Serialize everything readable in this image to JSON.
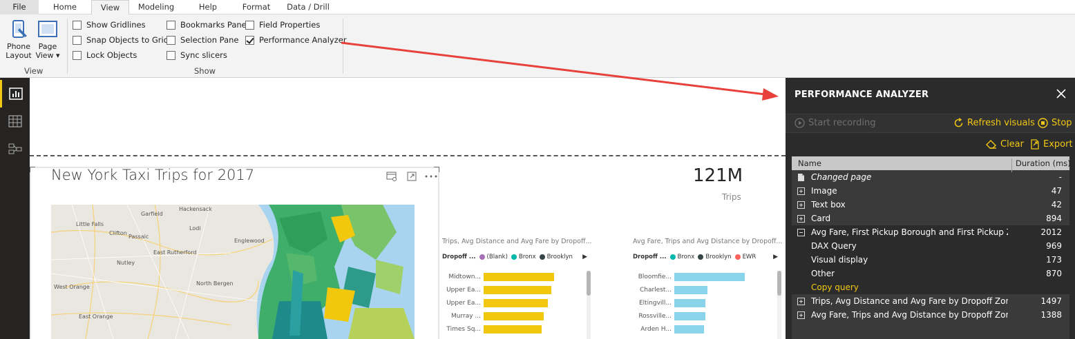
{
  "ribbon": {
    "tabs": [
      "File",
      "Home",
      "View",
      "Modeling",
      "Help",
      "Format",
      "Data / Drill"
    ],
    "active_tab": "View",
    "view_group": {
      "phone_layout_line1": "Phone",
      "phone_layout_line2": "Layout",
      "page_view_line1": "Page",
      "page_view_line2": "View ▾",
      "label": "View"
    },
    "show_group": {
      "label": "Show",
      "checkboxes": [
        {
          "label": "Show Gridlines",
          "checked": false
        },
        {
          "label": "Snap Objects to Grid",
          "checked": false
        },
        {
          "label": "Lock Objects",
          "checked": false
        },
        {
          "label": "Bookmarks Pane",
          "checked": false
        },
        {
          "label": "Selection Pane",
          "checked": false
        },
        {
          "label": "Sync slicers",
          "checked": false
        },
        {
          "label": "Field Properties",
          "checked": false
        },
        {
          "label": "Performance Analyzer",
          "checked": true
        }
      ]
    }
  },
  "canvas": {
    "map_title": "New York Taxi Trips for 2017",
    "map_labels": [
      "Hackensack",
      "Little Falls",
      "Garfield",
      "Clifton",
      "Passaic",
      "East Rutherford",
      "Nutley",
      "West Orange",
      "North Bergen",
      "East Orange",
      "Lodi",
      "Englewood"
    ],
    "card": {
      "value": "121M",
      "label": "Trips"
    },
    "bar_visual_1": {
      "title": "Trips, Avg Distance and Avg Fare by Dropoff...",
      "legend_label": "Dropoff ...",
      "legend": [
        {
          "name": "(Blank)",
          "color": "#a66fb5"
        },
        {
          "name": "Bronx",
          "color": "#01b8aa"
        },
        {
          "name": "Brooklyn",
          "color": "#374649"
        }
      ],
      "bars": [
        {
          "label": "Midtown...",
          "value": 100
        },
        {
          "label": "Upper Ea...",
          "value": 96
        },
        {
          "label": "Upper Ea...",
          "value": 91
        },
        {
          "label": "Murray ...",
          "value": 85
        },
        {
          "label": "Times Sq...",
          "value": 82
        }
      ],
      "bar_color": "#f2c80f"
    },
    "bar_visual_2": {
      "title": "Avg Fare, Trips and Avg Distance by Dropoff...",
      "legend_label": "Dropoff ...",
      "legend": [
        {
          "name": "Bronx",
          "color": "#01b8aa"
        },
        {
          "name": "Brooklyn",
          "color": "#374649"
        },
        {
          "name": "EWR",
          "color": "#fd625e"
        }
      ],
      "bars": [
        {
          "label": "Bloomfie...",
          "value": 100
        },
        {
          "label": "Charlest...",
          "value": 47
        },
        {
          "label": "Eltingvill...",
          "value": 44
        },
        {
          "label": "Rossville...",
          "value": 44
        },
        {
          "label": "Arden H...",
          "value": 42
        }
      ],
      "bar_color": "#8ad4eb"
    }
  },
  "performance_analyzer": {
    "title": "PERFORMANCE ANALYZER",
    "start_recording": "Start recording",
    "refresh_visuals": "Refresh visuals",
    "stop": "Stop",
    "clear": "Clear",
    "export": "Export",
    "col_name": "Name",
    "col_duration": "Duration (ms)",
    "rows": [
      {
        "icon": "page",
        "name": "Changed page",
        "duration": "-",
        "style": "italic"
      },
      {
        "icon": "plus",
        "name": "Image",
        "duration": "47"
      },
      {
        "icon": "plus",
        "name": "Text box",
        "duration": "42"
      },
      {
        "icon": "plus",
        "name": "Card",
        "duration": "894"
      },
      {
        "icon": "minus",
        "name": "Avg Fare, First Pickup Borough and First Pickup Zone...",
        "duration": "2012",
        "selected": true
      },
      {
        "icon": "none",
        "name": "DAX Query",
        "duration": "969",
        "selected": true
      },
      {
        "icon": "none",
        "name": "Visual display",
        "duration": "173",
        "selected": true
      },
      {
        "icon": "none",
        "name": "Other",
        "duration": "870",
        "selected": true
      },
      {
        "icon": "none",
        "name": "Copy query",
        "duration": "",
        "style": "link",
        "selected": true
      },
      {
        "icon": "plus",
        "name": "Trips, Avg Distance and Avg Fare by Dropoff Zone a...",
        "duration": "1497"
      },
      {
        "icon": "plus",
        "name": "Avg Fare, Trips and Avg Distance by Dropoff Zone a...",
        "duration": "1388"
      }
    ]
  },
  "colors": {
    "accent_gold": "#f2c811",
    "pane_bg": "#2b2b2b",
    "annotation_arrow": "#e8403a"
  }
}
